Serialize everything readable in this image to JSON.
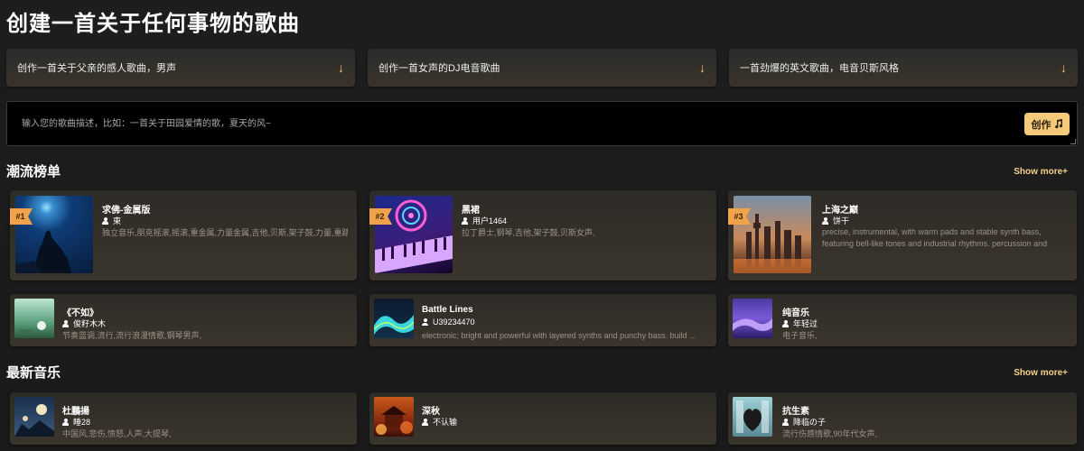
{
  "page_title": "创建一首关于任何事物的歌曲",
  "prompts": [
    {
      "label": "创作一首关于父亲的感人歌曲，男声"
    },
    {
      "label": "创作一首女声的DJ电音歌曲"
    },
    {
      "label": "一首劲爆的英文歌曲，电音贝斯风格"
    }
  ],
  "input": {
    "placeholder": "输入您的歌曲描述，比如：一首关于田园爱情的歌，夏天的风~",
    "value": ""
  },
  "create_button": {
    "label": "创作",
    "icon": "music-note-icon"
  },
  "trending": {
    "title": "潮流榜单",
    "show_more": "Show more+",
    "cards": [
      {
        "rank": "#1",
        "name": "求佛-金属版",
        "user": "東",
        "desc": "独立音乐,朋克摇滚,摇滚,重金属,力量金属,吉他,贝斯,架子鼓,力量,重踏,"
      },
      {
        "rank": "#2",
        "name": "黑裙",
        "user": "用户1464",
        "desc": "拉丁爵士,钢琴,吉他,架子鼓,贝斯女声,"
      },
      {
        "rank": "#3",
        "name": "上海之巅",
        "user": "饼干",
        "desc": "precise, instrumental, with warm pads and stable synth bass, featuring bell-like tones and industrial rhythms. percussion and horns..."
      },
      {
        "name": "《不如》",
        "user": "俊籽木木",
        "desc": "节奏蓝调,流行,流行浪漫情歌,钢琴男声,"
      },
      {
        "name": "Battle Lines",
        "user": "U39234470",
        "desc": "electronic; bright and powerful with layered synths and punchy bass. build ..."
      },
      {
        "name": "纯音乐",
        "user": "年轻过",
        "desc": "电子音乐,"
      }
    ]
  },
  "latest": {
    "title": "最新音乐",
    "show_more": "Show more+",
    "cards": [
      {
        "name": "杜鵬揚",
        "user": "睡28",
        "desc": "中国风,悲伤,愤怒,人声,大提琴,"
      },
      {
        "name": "深秋",
        "user": "不认输",
        "desc": ""
      },
      {
        "name": "抗生素",
        "user": "降临の子",
        "desc": "流行伤感情歌,90年代女声,"
      }
    ]
  },
  "colors": {
    "accent": "#f5c97a",
    "badge": "#f0a34a",
    "show_more": "#f4d28a"
  },
  "icons": {
    "prompt_arrow": "arrow-down-icon",
    "user": "user-icon"
  }
}
